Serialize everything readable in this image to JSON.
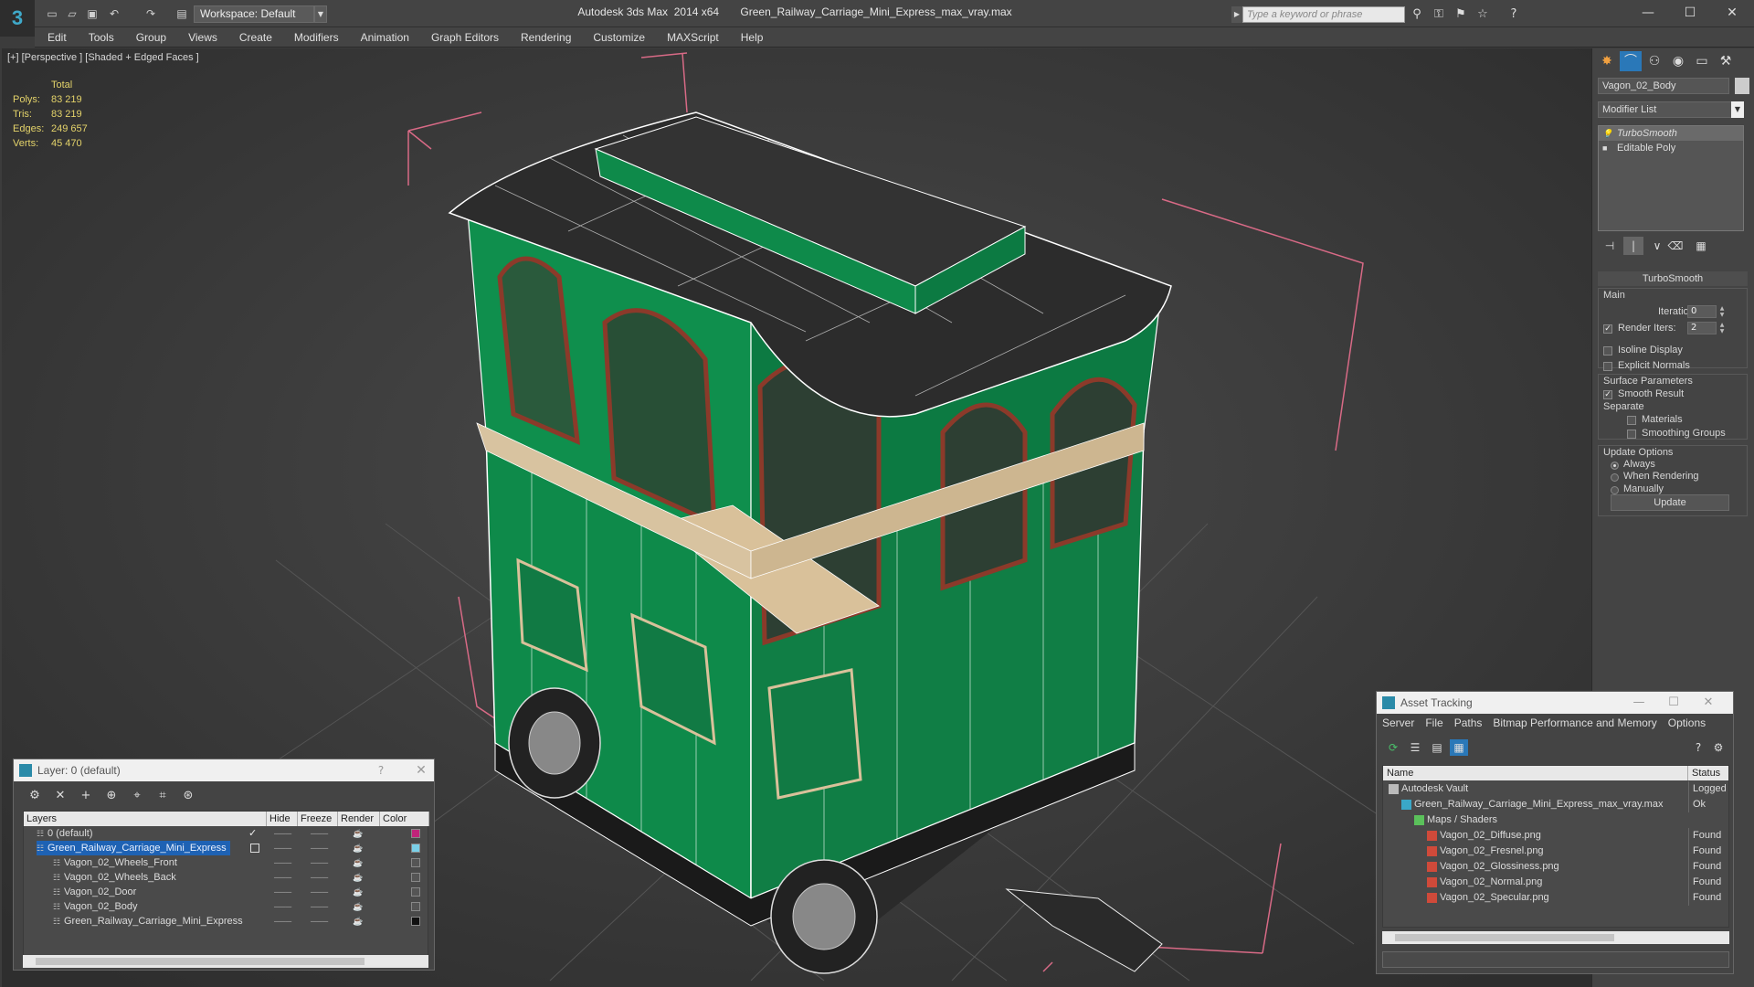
{
  "titlebar": {
    "workspace_label": "Workspace: Default",
    "window_title": "Autodesk 3ds Max  2014 x64       Green_Railway_Carriage_Mini_Express_max_vray.max",
    "search_placeholder": "Type a keyword or phrase"
  },
  "menu": [
    "Edit",
    "Tools",
    "Group",
    "Views",
    "Create",
    "Modifiers",
    "Animation",
    "Graph Editors",
    "Rendering",
    "Customize",
    "MAXScript",
    "Help"
  ],
  "viewport": {
    "label": "[+] [Perspective ] [Shaded + Edged Faces ]",
    "stats": {
      "total_label": "Total",
      "rows": [
        {
          "key": "Polys:",
          "value": "83 219"
        },
        {
          "key": "Tris:",
          "value": "83 219"
        },
        {
          "key": "Edges:",
          "value": "249 657"
        },
        {
          "key": "Verts:",
          "value": "45 470"
        }
      ]
    },
    "colors": {
      "carriage_green": "#0e8a4a",
      "roof": "#2c2c2c",
      "trim": "#d8c3a0",
      "bbox": "#d86a86"
    }
  },
  "command_panel": {
    "object_name": "Vagon_02_Body",
    "modifier_list": "Modifier List",
    "stack": [
      {
        "label": "TurboSmooth",
        "selected": true
      },
      {
        "label": "Editable Poly",
        "selected": false
      }
    ],
    "turbosmooth": {
      "title": "TurboSmooth",
      "main_label": "Main",
      "iterations_label": "Iterations:",
      "iterations_value": "0",
      "render_iters_label": "Render Iters:",
      "render_iters_value": "2",
      "isoline_label": "Isoline Display",
      "explicit_normals_label": "Explicit Normals",
      "surface_params_label": "Surface Parameters",
      "smooth_result_label": "Smooth Result",
      "separate_label": "Separate",
      "materials_label": "Materials",
      "smoothing_groups_label": "Smoothing Groups",
      "update_options_label": "Update Options",
      "always_label": "Always",
      "when_rendering_label": "When Rendering",
      "manually_label": "Manually",
      "update_button": "Update"
    }
  },
  "layer_window": {
    "title": "Layer: 0 (default)",
    "help": "?",
    "columns": [
      "Layers",
      "Hide",
      "Freeze",
      "Render",
      "Color"
    ],
    "rows": [
      {
        "name": "0 (default)",
        "indent": 1,
        "selected": false,
        "color": "#c0247a"
      },
      {
        "name": "Green_Railway_Carriage_Mini_Express",
        "indent": 1,
        "selected": true,
        "color": "#7ad0e8"
      },
      {
        "name": "Vagon_02_Wheels_Front",
        "indent": 2,
        "selected": false,
        "color": "#555555"
      },
      {
        "name": "Vagon_02_Wheels_Back",
        "indent": 2,
        "selected": false,
        "color": "#555555"
      },
      {
        "name": "Vagon_02_Door",
        "indent": 2,
        "selected": false,
        "color": "#555555"
      },
      {
        "name": "Vagon_02_Body",
        "indent": 2,
        "selected": false,
        "color": "#555555"
      },
      {
        "name": "Green_Railway_Carriage_Mini_Express",
        "indent": 2,
        "selected": false,
        "color": "#111111"
      }
    ]
  },
  "asset_window": {
    "title": "Asset Tracking",
    "menu": [
      "Server",
      "File",
      "Paths",
      "Bitmap Performance and Memory",
      "Options"
    ],
    "columns": [
      "Name",
      "Status"
    ],
    "rows": [
      {
        "name": "Autodesk Vault",
        "status": "Logged O",
        "indent": 1,
        "icon": "vault-icon"
      },
      {
        "name": "Green_Railway_Carriage_Mini_Express_max_vray.max",
        "status": "Ok",
        "indent": 2,
        "icon": "max-file-icon"
      },
      {
        "name": "Maps / Shaders",
        "status": "",
        "indent": 3,
        "icon": "maps-folder-icon"
      },
      {
        "name": "Vagon_02_Diffuse.png",
        "status": "Found",
        "indent": 4,
        "icon": "png-icon"
      },
      {
        "name": "Vagon_02_Fresnel.png",
        "status": "Found",
        "indent": 4,
        "icon": "png-icon"
      },
      {
        "name": "Vagon_02_Glossiness.png",
        "status": "Found",
        "indent": 4,
        "icon": "png-icon"
      },
      {
        "name": "Vagon_02_Normal.png",
        "status": "Found",
        "indent": 4,
        "icon": "png-icon"
      },
      {
        "name": "Vagon_02_Specular.png",
        "status": "Found",
        "indent": 4,
        "icon": "png-icon"
      }
    ]
  }
}
